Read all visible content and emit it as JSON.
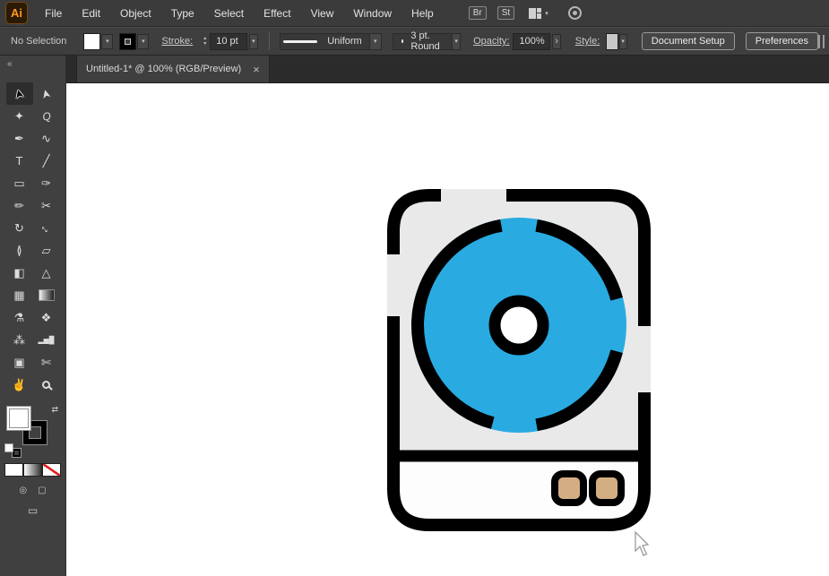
{
  "app": {
    "logo_text": "Ai"
  },
  "menubar": {
    "items": [
      "File",
      "Edit",
      "Object",
      "Type",
      "Select",
      "Effect",
      "View",
      "Window",
      "Help"
    ],
    "bridge_label": "Br",
    "stock_label": "St"
  },
  "controlbar": {
    "selection_status": "No Selection",
    "stroke_label": "Stroke:",
    "stroke_value": "10 pt",
    "profile_value": "Uniform",
    "brush_value": "3 pt. Round",
    "opacity_label": "Opacity:",
    "opacity_value": "100%",
    "style_label": "Style:",
    "document_setup_label": "Document Setup",
    "preferences_label": "Preferences"
  },
  "tabbar": {
    "collapse_glyph": "«",
    "active_tab": "Untitled-1* @ 100% (RGB/Preview)",
    "close_glyph": "×"
  },
  "icons": {
    "dropdown": "▾",
    "stepper_up": "▴",
    "stepper_down": "▾",
    "flyout": "›",
    "swap": "⇄",
    "draw_normal": "◎",
    "draw_behind": "▢",
    "screen_mode": "▭"
  },
  "toolbar": {
    "tools": [
      {
        "name": "selection",
        "glyph": "➤"
      },
      {
        "name": "direct-selection",
        "glyph": "➤"
      },
      {
        "name": "magic-wand",
        "glyph": "✦"
      },
      {
        "name": "lasso",
        "glyph": "Q"
      },
      {
        "name": "pen",
        "glyph": "✒"
      },
      {
        "name": "curvature",
        "glyph": "∿"
      },
      {
        "name": "type",
        "glyph": "T"
      },
      {
        "name": "line-segment",
        "glyph": "╱"
      },
      {
        "name": "rectangle",
        "glyph": "▭"
      },
      {
        "name": "paintbrush",
        "glyph": "✑"
      },
      {
        "name": "pencil",
        "glyph": "✏"
      },
      {
        "name": "scissors",
        "glyph": "✂"
      },
      {
        "name": "rotate",
        "glyph": "↻"
      },
      {
        "name": "scale",
        "glyph": "↔"
      },
      {
        "name": "width",
        "glyph": "≬"
      },
      {
        "name": "free-transform",
        "glyph": "▱"
      },
      {
        "name": "shape-builder",
        "glyph": "◧"
      },
      {
        "name": "perspective-grid",
        "glyph": "△"
      },
      {
        "name": "mesh",
        "glyph": "▦"
      },
      {
        "name": "gradient",
        "glyph": ""
      },
      {
        "name": "eyedropper",
        "glyph": "⚗"
      },
      {
        "name": "blend",
        "glyph": "❖"
      },
      {
        "name": "symbol-sprayer",
        "glyph": "⁂"
      },
      {
        "name": "column-graph",
        "glyph": "▂▅█"
      },
      {
        "name": "artboard",
        "glyph": "▣"
      },
      {
        "name": "slice",
        "glyph": "✄"
      },
      {
        "name": "hand",
        "glyph": "✌"
      },
      {
        "name": "zoom",
        "glyph": ""
      }
    ]
  },
  "artwork": {
    "description": "hot-plate / burner icon with broken black outlines",
    "colors": {
      "body": "#e9e9e9",
      "panel": "#fdfdfd",
      "disc": "#29abe2",
      "outline": "#000000",
      "center": "#ffffff",
      "button": "#d4ae83"
    }
  }
}
